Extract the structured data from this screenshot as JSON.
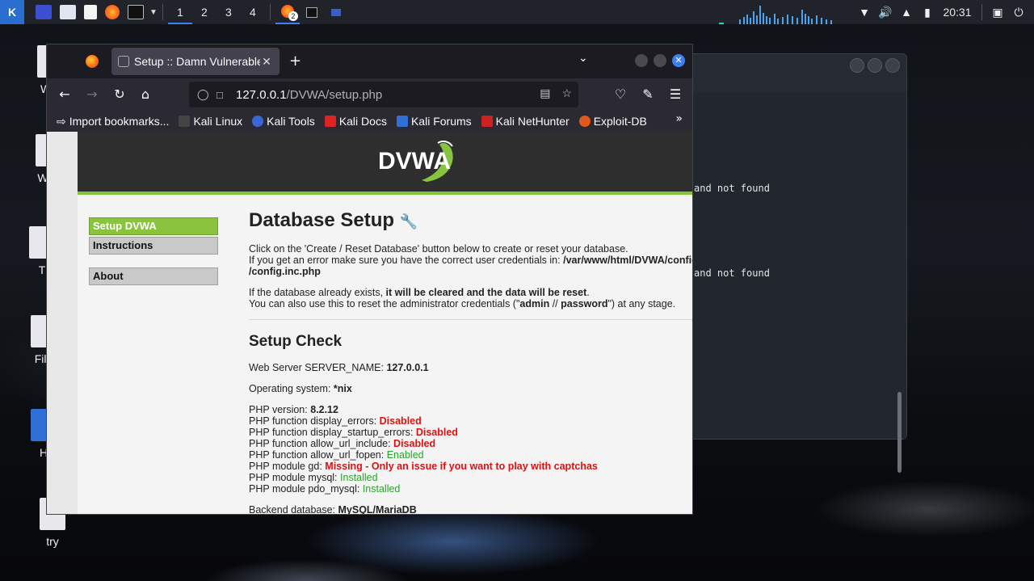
{
  "panel": {
    "workspaces": [
      "1",
      "2",
      "3",
      "4"
    ],
    "active_workspace": "1",
    "firefox_badge": "2",
    "clock": "20:31",
    "icons": [
      "kali-menu-icon",
      "files-icon",
      "file-manager-icon",
      "text-editor-icon",
      "firefox-icon",
      "terminal-icon",
      "wifi-icon",
      "volume-icon",
      "notifications-icon",
      "battery-icon",
      "lock-icon",
      "power-icon"
    ]
  },
  "desktop": {
    "icons": [
      {
        "label": "Win"
      },
      {
        "label": "WIN"
      },
      {
        "label": "T"
      },
      {
        "label": "File"
      },
      {
        "label": "H"
      },
      {
        "label": "try"
      }
    ]
  },
  "terminal": {
    "lines": [
      "and not found",
      "and not found"
    ]
  },
  "browser": {
    "tab_title": "Setup :: Damn Vulnerable",
    "new_tab": "+",
    "url_host": "127.0.0.1",
    "url_path": "/DVWA/setup.php",
    "bookmarks": [
      "Import bookmarks...",
      "Kali Linux",
      "Kali Tools",
      "Kali Docs",
      "Kali Forums",
      "Kali NetHunter",
      "Exploit-DB"
    ]
  },
  "dvwa": {
    "logo": "DVWA",
    "menu": [
      "Setup DVWA",
      "Instructions",
      "About"
    ],
    "heading": "Database Setup",
    "intro1": "Click on the 'Create / Reset Database' button below to create or reset your database.",
    "intro2a": "If you get an error make sure you have the correct user credentials in: ",
    "intro2b": "/var/www/html/DVWA/config",
    "intro2c": "/config.inc.php",
    "exists1a": "If the database already exists, ",
    "exists1b": "it will be cleared and the data will be reset",
    "exists1c": ".",
    "exists2a": "You can also use this to reset the administrator credentials (\"",
    "exists2b": "admin",
    "exists2c": " // ",
    "exists2d": "password",
    "exists2e": "\") at any stage.",
    "setup_check": "Setup Check",
    "server_name_label": "Web Server SERVER_NAME: ",
    "server_name": "127.0.0.1",
    "os_label": "Operating system: ",
    "os": "*nix",
    "php_version_label": "PHP version: ",
    "php_version": "8.2.12",
    "checks": [
      {
        "label": "PHP function display_errors: ",
        "value": "Disabled",
        "status": "red"
      },
      {
        "label": "PHP function display_startup_errors: ",
        "value": "Disabled",
        "status": "red"
      },
      {
        "label": "PHP function allow_url_include: ",
        "value": "Disabled",
        "status": "red"
      },
      {
        "label": "PHP function allow_url_fopen: ",
        "value": "Enabled",
        "status": "green"
      },
      {
        "label": "PHP module gd: ",
        "value": "Missing - Only an issue if you want to play with captchas",
        "status": "red"
      },
      {
        "label": "PHP module mysql: ",
        "value": "Installed",
        "status": "green"
      },
      {
        "label": "PHP module pdo_mysql: ",
        "value": "Installed",
        "status": "green"
      }
    ],
    "backend_label": "Backend database: ",
    "backend": "MySQL/MariaDB"
  }
}
